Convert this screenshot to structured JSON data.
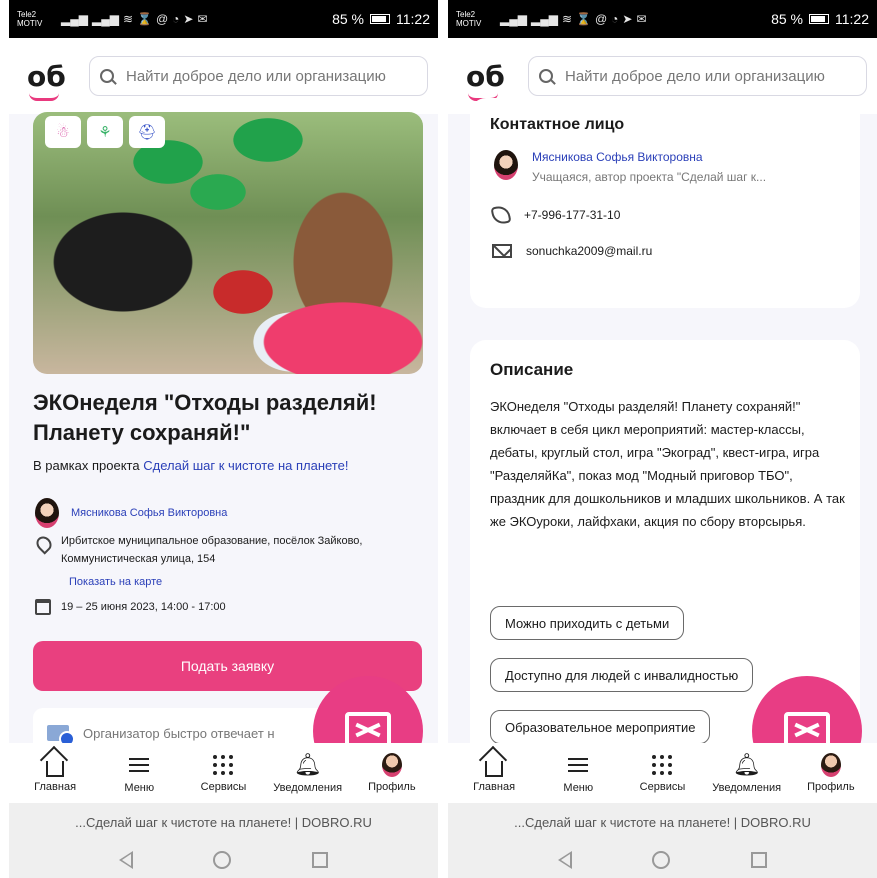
{
  "status": {
    "carrier_line1": "Tele2",
    "carrier_line2": "MOTIV",
    "battery": "85 %",
    "time": "11:22"
  },
  "search": {
    "placeholder": "Найти доброе дело или организацию"
  },
  "logo": {
    "text": "об"
  },
  "left": {
    "title": "ЭКОнеделя \"Отходы разделяй! Планету сохраняй!\"",
    "project_prefix": "В рамках проекта",
    "project_link": "Сделай шаг к чистоте на планете!",
    "organizer": "Мясникова Софья Викторовна",
    "address": "Ирбитское муниципальное образование, посёлок Зайково, Коммунистическая улица, 154",
    "map_link": "Показать на карте",
    "date": "19 – 25 июня 2023, 14:00 - 17:00",
    "apply_button": "Подать заявку",
    "responds_fast": "Организатор быстро отвечает н"
  },
  "right": {
    "contact_heading": "Контактное лицо",
    "contact_name": "Мясникова Софья Викторовна",
    "contact_role": "Учащаяся, автор проекта \"Сделай шаг к...",
    "phone": "+7-996-177-31-10",
    "email": "sonuchka2009@mail.ru",
    "description_heading": "Описание",
    "description": "ЭКОнеделя \"Отходы разделяй! Планету сохраняй!\" включает в себя цикл мероприятий: мастер-классы, дебаты, круглый стол, игра \"Экоград\", квест-игра, игра \"РазделяйКа\", показ мод \"Модный приговор ТБО\", праздник для дошкольников и младших школьников. А так же ЭКОуроки, лайфхаки, акция по сбору вторсырья.",
    "chips": [
      "Можно приходить с детьми",
      "Доступно для людей с инвалидностью",
      "Образовательное мероприятие"
    ]
  },
  "nav": {
    "home": "Главная",
    "menu": "Меню",
    "services": "Сервисы",
    "notifications": "Уведомления",
    "profile": "Профиль"
  },
  "browser": {
    "page_title": "...Сделай шаг к чистоте на планете! | DOBRO.RU"
  },
  "colors": {
    "accent": "#e9407f",
    "link": "#2a3fb8"
  }
}
